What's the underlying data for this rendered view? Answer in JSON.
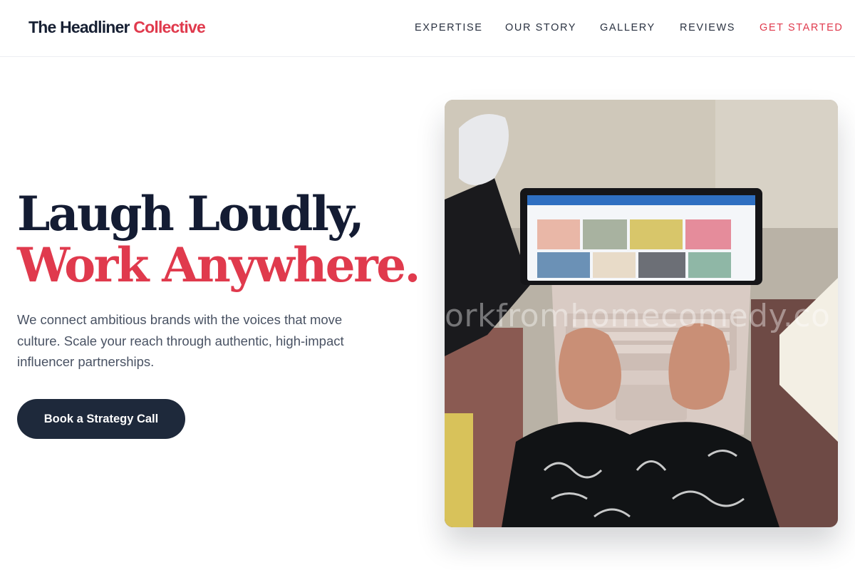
{
  "brand": {
    "name_main": "The Headliner",
    "name_accent": "Collective"
  },
  "nav": {
    "items": [
      {
        "label": "EXPERTISE"
      },
      {
        "label": "OUR STORY"
      },
      {
        "label": "GALLERY"
      },
      {
        "label": "REVIEWS"
      },
      {
        "label": "GET STARTED"
      }
    ]
  },
  "hero": {
    "title_line1": "Laugh Loudly,",
    "title_line2": "Work Anywhere.",
    "description": "We connect ambitious brands with the voices that move culture. Scale your reach through authentic, high-impact influencer partnerships.",
    "cta_label": "Book a Strategy Call"
  },
  "image": {
    "watermark": "orkfromhomecomedy.co"
  },
  "colors": {
    "accent": "#e03a4d",
    "navy": "#1e293b",
    "heading": "#141c33",
    "body_text": "#495263"
  }
}
